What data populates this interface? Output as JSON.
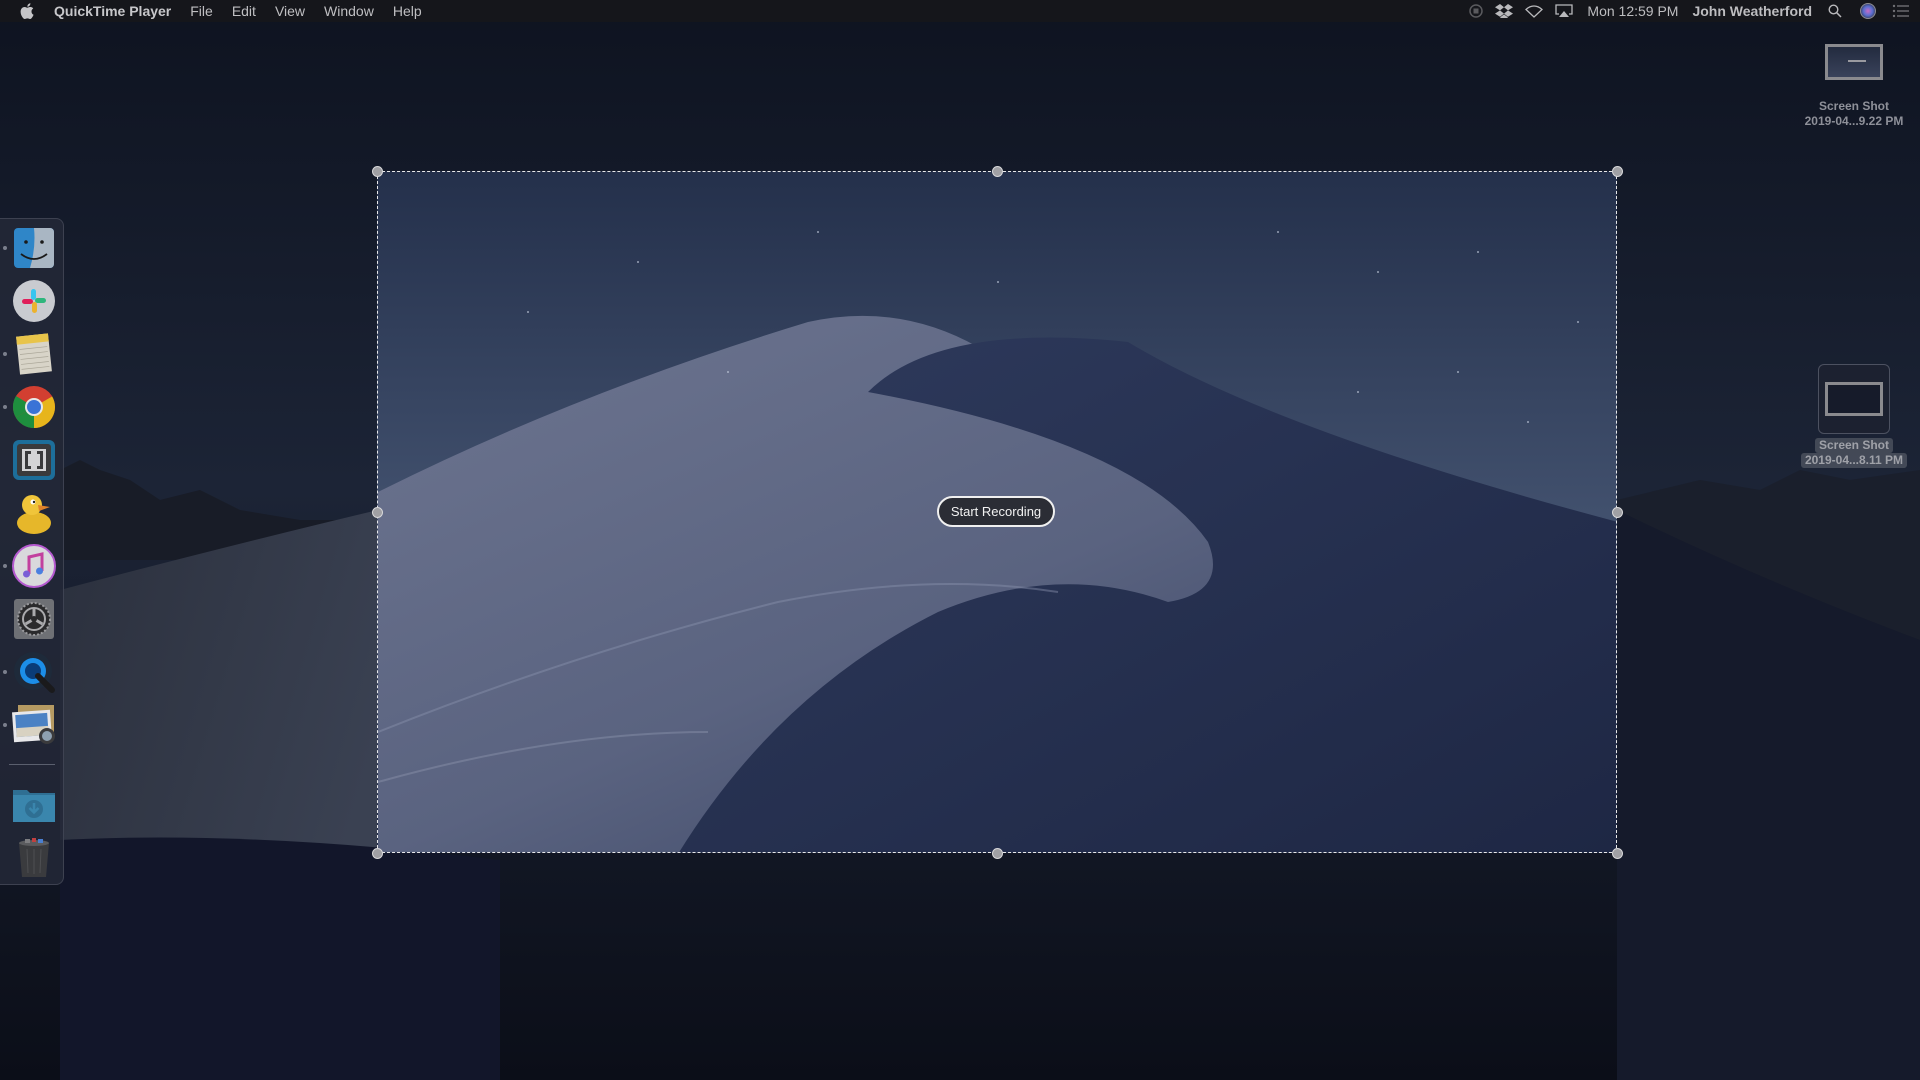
{
  "menubar": {
    "apple_icon": "apple-logo-icon",
    "app_name": "QuickTime Player",
    "menus": [
      "File",
      "Edit",
      "View",
      "Window",
      "Help"
    ],
    "status_icons": [
      "record-stop-icon",
      "dropbox-icon",
      "wifi-icon",
      "airplay-icon"
    ],
    "clock": "Mon 12:59 PM",
    "user": "John Weatherford",
    "right_icons": [
      "spotlight-search-icon",
      "siri-icon",
      "notification-center-icon"
    ]
  },
  "dock": {
    "apps": [
      {
        "name": "Finder",
        "icon": "finder-icon",
        "running": true
      },
      {
        "name": "Slack",
        "icon": "slack-icon",
        "running": false
      },
      {
        "name": "Notes",
        "icon": "notes-icon",
        "running": true
      },
      {
        "name": "Google Chrome",
        "icon": "chrome-icon",
        "running": true
      },
      {
        "name": "Brackets",
        "icon": "brackets-icon",
        "running": false
      },
      {
        "name": "Cyberduck",
        "icon": "cyberduck-icon",
        "running": false
      },
      {
        "name": "iTunes",
        "icon": "itunes-icon",
        "running": true
      },
      {
        "name": "System Preferences",
        "icon": "system-preferences-icon",
        "running": false
      },
      {
        "name": "QuickTime Player",
        "icon": "quicktime-icon",
        "running": true
      },
      {
        "name": "Preview",
        "icon": "preview-icon",
        "running": true
      }
    ],
    "stacks": [
      {
        "name": "Downloads",
        "icon": "downloads-folder-icon"
      },
      {
        "name": "Trash",
        "icon": "trash-icon"
      }
    ]
  },
  "recording": {
    "start_label": "Start Recording"
  },
  "desktop_files": [
    {
      "line1": "Screen Shot",
      "line2": "2019-04...9.22 PM",
      "selected": false
    },
    {
      "line1": "Screen Shot",
      "line2": "2019-04...8.11 PM",
      "selected": true
    }
  ]
}
